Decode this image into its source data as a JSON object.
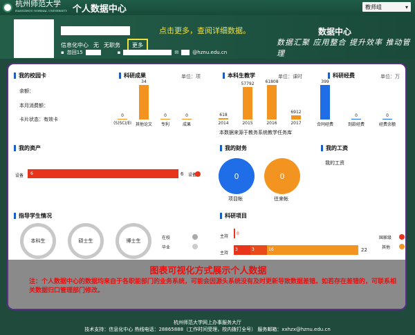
{
  "header": {
    "university_name": "杭州师范大学",
    "university_en": "HANGZHOU NORMAL UNIVERSITY",
    "system_title": "个人数据中心",
    "user_role": "教师组",
    "dropdown_icon": "caret-down-icon"
  },
  "profile": {
    "department": "信息化中心",
    "title_value": "无",
    "position": "无职务",
    "more_label": "更多",
    "id_prefix": "忽回15",
    "email_suffix": "@hznu.edu.cn"
  },
  "banner": {
    "hint": "点击更多，查阅详细数据。",
    "center_title": "数据中心",
    "slogan": "数据汇聚  应用整合  提升效率  推动管理"
  },
  "campus_card": {
    "title": "我的校园卡",
    "balance_label": "余额：",
    "monthly_label": "本月消费额：",
    "status_label": "卡片状态：",
    "status_value": "有效卡"
  },
  "research_output": {
    "title": "科研成果",
    "unit": "单位：项",
    "chart_data": {
      "type": "bar",
      "categories": [
        "(S)SCI/EI",
        "其他论文",
        "专利",
        "成果"
      ],
      "values": [
        0,
        34,
        0,
        0
      ]
    }
  },
  "teaching": {
    "title": "本科生教学",
    "unit": "单位：课时",
    "source_note": "本数据来源于教务系统教学任务库",
    "chart_data": {
      "type": "bar",
      "categories": [
        "2014",
        "2015",
        "2016",
        "2017"
      ],
      "values": [
        618,
        57792,
        61808,
        6912
      ]
    }
  },
  "funding": {
    "title": "科研经费",
    "unit": "单位：万",
    "chart_data": {
      "type": "bar",
      "categories": [
        "合同经费",
        "到款经费",
        "经费余额"
      ],
      "values": [
        399,
        0,
        0
      ]
    }
  },
  "assets": {
    "title": "我的资产",
    "row_label": "设备",
    "bar_value": "6",
    "end_value": "6",
    "legend_label": "设备"
  },
  "finance": {
    "title": "我的财务",
    "items": [
      {
        "value": "0",
        "label": "项目帐"
      },
      {
        "value": "0",
        "label": "往来帐"
      }
    ]
  },
  "salary": {
    "title": "我的工资",
    "text": "我的工资"
  },
  "students": {
    "title": "指导学生情况",
    "rings": [
      "本科生",
      "硕士生",
      "博士生"
    ],
    "legend": [
      "在校",
      "毕业"
    ]
  },
  "projects": {
    "title": "科研项目",
    "rows": [
      {
        "label": "主持",
        "values": [
          "0"
        ]
      },
      {
        "label": "主持",
        "values": [
          "3",
          "3",
          "16"
        ],
        "total": "22"
      }
    ],
    "legend": [
      "国家级",
      "其他"
    ]
  },
  "notice": {
    "title": "图表可视化方式展示个人数据",
    "body": "注：个人数据中心的数据均来自于各职能部门的业务系统，可能会因源头系统没有及时更新导致数据差错。如若存在差错的，可联系相关数据归口管理部门修改。"
  },
  "footer": {
    "line1": "杭州师范大学网上办事服务大厅",
    "line2": "技术支持：信息化中心 热线电话：28865888（工作时间受理，校内拨打全号） 服务邮箱：xxhzx@hznu.edu.cn"
  },
  "colors": {
    "accent_blue": "#1b5ebe",
    "bar_orange": "#f39421",
    "bar_blue": "#1f6ee8",
    "red": "#e8341a",
    "purple_border": "#5b2f8a"
  }
}
